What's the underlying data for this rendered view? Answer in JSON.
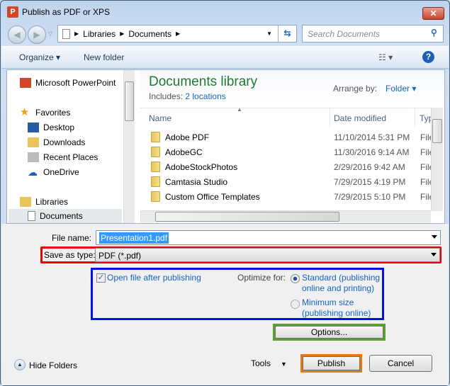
{
  "window": {
    "title": "Publish as PDF or XPS",
    "close": "✕"
  },
  "address": {
    "segments": [
      "Libraries",
      "Documents"
    ]
  },
  "search": {
    "placeholder": "Search Documents"
  },
  "toolbar": {
    "organize": "Organize",
    "new_folder": "New folder"
  },
  "nav": {
    "items": [
      {
        "label": "Microsoft PowerPoint",
        "icon": "powerpoint-icon"
      },
      {
        "label": "Favorites",
        "icon": "star-icon"
      },
      {
        "label": "Desktop",
        "icon": "desktop-icon"
      },
      {
        "label": "Downloads",
        "icon": "downloads-icon"
      },
      {
        "label": "Recent Places",
        "icon": "recent-places-icon"
      },
      {
        "label": "OneDrive",
        "icon": "onedrive-icon"
      },
      {
        "label": "Libraries",
        "icon": "libraries-icon"
      },
      {
        "label": "Documents",
        "icon": "document-icon"
      }
    ]
  },
  "library": {
    "title": "Documents library",
    "includes_label": "Includes:",
    "includes_link": "2 locations",
    "arrange_label": "Arrange by:",
    "arrange_value": "Folder"
  },
  "columns": [
    "Name",
    "Date modified",
    "Typ"
  ],
  "files": [
    {
      "name": "Adobe PDF",
      "date": "11/10/2014 5:31 PM",
      "type": "File"
    },
    {
      "name": "AdobeGC",
      "date": "11/30/2016 9:14 AM",
      "type": "File"
    },
    {
      "name": "AdobeStockPhotos",
      "date": "2/29/2016 9:42 AM",
      "type": "File"
    },
    {
      "name": "Camtasia Studio",
      "date": "7/29/2015 4:19 PM",
      "type": "File"
    },
    {
      "name": "Custom Office Templates",
      "date": "7/29/2015 5:10 PM",
      "type": "File"
    }
  ],
  "form": {
    "file_name_label": "File name:",
    "file_name_value": "Presentation1.pdf",
    "save_type_label": "Save as type:",
    "save_type_value": "PDF (*.pdf)",
    "open_after_label": "Open file after publishing",
    "open_after_checked": true,
    "optimize_label": "Optimize for:",
    "opt_standard_1": "Standard (publishing",
    "opt_standard_2": "online and printing)",
    "opt_min_1": "Minimum size",
    "opt_min_2": "(publishing online)",
    "selected": "standard",
    "options_button": "Options..."
  },
  "footer": {
    "hide_folders": "Hide Folders",
    "tools": "Tools",
    "publish": "Publish",
    "cancel": "Cancel"
  },
  "highlight_colors": {
    "save_type": "#e8000b",
    "options_group": "#0010e8",
    "options_button": "#5aa02c",
    "publish": "#e07a14"
  }
}
